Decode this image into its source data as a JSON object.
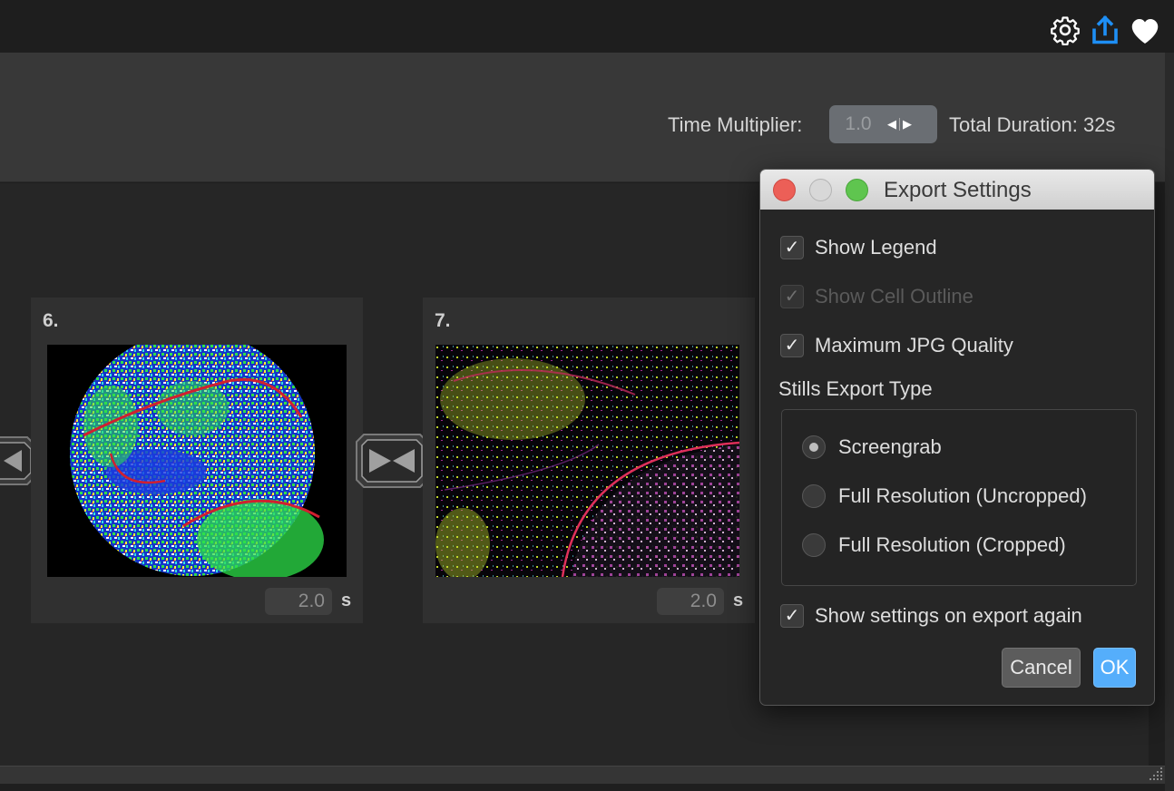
{
  "toolbar": {
    "icons": [
      "gear-icon",
      "share-icon",
      "heart-icon"
    ],
    "accent_color": "#1e8ff5"
  },
  "header": {
    "time_multiplier_label": "Time Multiplier:",
    "time_multiplier_value": "1.0",
    "total_duration": "Total Duration: 32s"
  },
  "slides": [
    {
      "number": "6.",
      "duration": "2.0",
      "unit": "s"
    },
    {
      "number": "7.",
      "duration": "2.0",
      "unit": "s"
    }
  ],
  "dialog": {
    "title": "Export Settings",
    "show_legend": {
      "label": "Show Legend",
      "checked": true
    },
    "show_cell_outline": {
      "label": "Show Cell Outline",
      "checked": true,
      "disabled": true
    },
    "max_jpg_quality": {
      "label": "Maximum JPG Quality",
      "checked": true
    },
    "stills_export_type_label": "Stills Export Type",
    "options": [
      {
        "label": "Screengrab",
        "selected": true
      },
      {
        "label": "Full Resolution (Uncropped)",
        "selected": false
      },
      {
        "label": "Full Resolution (Cropped)",
        "selected": false
      }
    ],
    "show_settings_again": {
      "label": "Show settings on export again",
      "checked": true
    },
    "cancel_label": "Cancel",
    "ok_label": "OK"
  }
}
